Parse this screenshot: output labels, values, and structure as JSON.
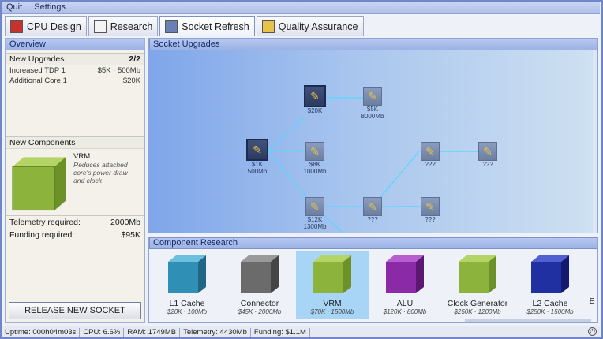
{
  "menu": {
    "quit": "Quit",
    "settings": "Settings"
  },
  "tabs": [
    {
      "label": "CPU Design",
      "icon": "cpu-icon"
    },
    {
      "label": "Research",
      "icon": "clipboard-icon"
    },
    {
      "label": "Socket Refresh",
      "icon": "socket-icon"
    },
    {
      "label": "Quality Assurance",
      "icon": "folder-icon"
    }
  ],
  "overview": {
    "title": "Overview",
    "new_upgrades_label": "New Upgrades",
    "new_upgrades_count": "2/2",
    "upgrades": [
      {
        "name": "Increased TDP 1",
        "cost": "$5K · 500Mb"
      },
      {
        "name": "Additional Core 1",
        "cost": "$20K"
      }
    ],
    "new_components_label": "New Components",
    "component_name": "VRM",
    "component_desc": "Reduces attached core's power draw and clock",
    "telemetry_label": "Telemetry required:",
    "telemetry_value": "2000Mb",
    "funding_label": "Funding required:",
    "funding_value": "$95K",
    "release_button": "RELEASE NEW SOCKET",
    "colors": {
      "component": "#8cb43c"
    }
  },
  "socket_upgrades": {
    "title": "Socket Upgrades",
    "nodes": [
      {
        "id": "n1",
        "label1": "$1K",
        "label2": "500Mb",
        "selected": true
      },
      {
        "id": "n2",
        "label1": "$20K",
        "label2": "",
        "selected": true
      },
      {
        "id": "n3",
        "label1": "$5K",
        "label2": "8000Mb",
        "selected": false
      },
      {
        "id": "n4",
        "label1": "$8K",
        "label2": "1000Mb",
        "selected": false
      },
      {
        "id": "n5",
        "label1": "$12K",
        "label2": "1300Mb",
        "selected": false
      },
      {
        "id": "n6",
        "label1": "???",
        "label2": "",
        "selected": false
      },
      {
        "id": "n7",
        "label1": "???",
        "label2": "",
        "selected": false
      },
      {
        "id": "n8",
        "label1": "???",
        "label2": "",
        "selected": false
      },
      {
        "id": "n9",
        "label1": "???",
        "label2": "",
        "selected": false
      }
    ]
  },
  "component_research": {
    "title": "Component Research",
    "items": [
      {
        "name": "L1 Cache",
        "price": "$20K · 100Mb",
        "color": "#2f8fb5"
      },
      {
        "name": "Connector",
        "price": "$45K · 2000Mb",
        "color": "#6b6b6b"
      },
      {
        "name": "VRM",
        "price": "$70K · 1500Mb",
        "color": "#8cb43c",
        "selected": true
      },
      {
        "name": "ALU",
        "price": "$120K · 800Mb",
        "color": "#8a2aa6"
      },
      {
        "name": "Clock Generator",
        "price": "$250K · 1200Mb",
        "color": "#8cb43c"
      },
      {
        "name": "L2 Cache",
        "price": "$250K · 1500Mb",
        "color": "#2030a0"
      },
      {
        "name": "E",
        "price": "",
        "color": "#888888"
      }
    ]
  },
  "status": {
    "uptime": "Uptime: 000h04m03s",
    "cpu": "CPU: 6.6%",
    "ram": "RAM: 1749MB",
    "telemetry": "Telemetry: 4430Mb",
    "funding": "Funding: $1.1M"
  }
}
